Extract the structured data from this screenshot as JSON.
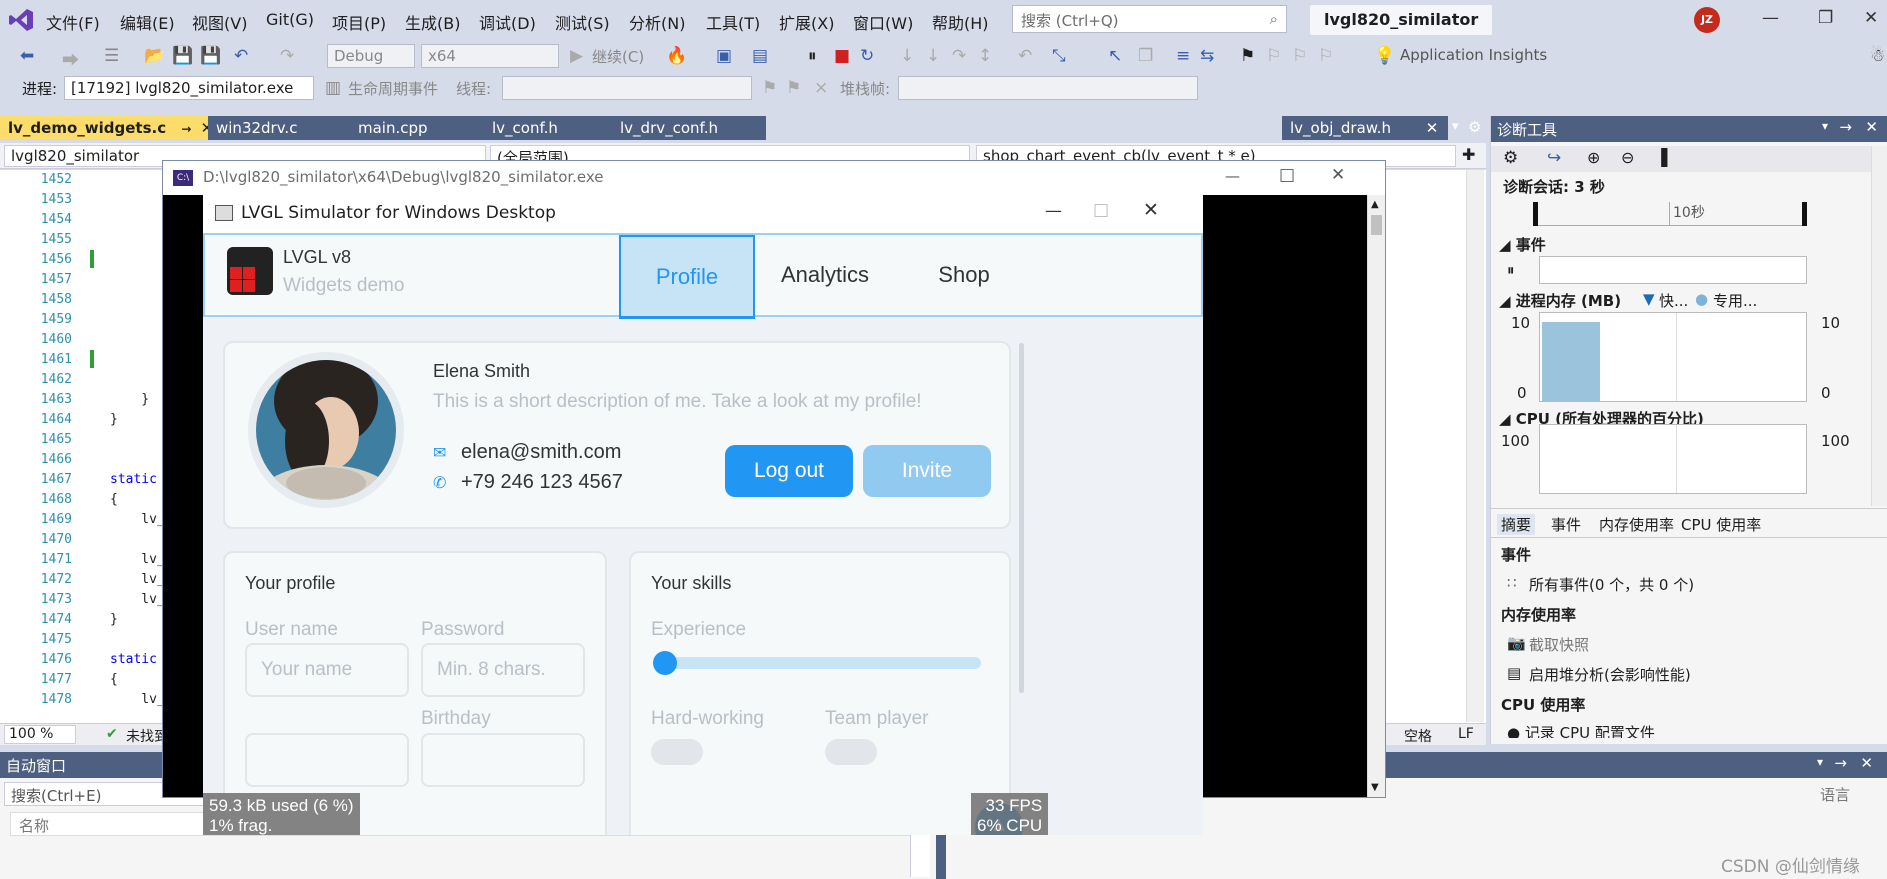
{
  "menubar": {
    "items": [
      "文件(F)",
      "编辑(E)",
      "视图(V)",
      "Git(G)",
      "项目(P)",
      "生成(B)",
      "调试(D)",
      "测试(S)",
      "分析(N)",
      "工具(T)",
      "扩展(X)",
      "窗口(W)",
      "帮助(H)"
    ],
    "search_placeholder": "搜索 (Ctrl+Q)",
    "project_name": "lvgl820_similator",
    "user_initials": "JZ"
  },
  "toolbar": {
    "config": "Debug",
    "platform": "x64",
    "continue_label": "继续(C)",
    "insights": "Application Insights"
  },
  "debugbar": {
    "process_label": "进程:",
    "process_value": "[17192] lvgl820_similator.exe",
    "lifecycle_label": "生命周期事件",
    "thread_label": "线程:",
    "stack_label": "堆栈帧:"
  },
  "tabs": [
    "lv_demo_widgets.c",
    "win32drv.c",
    "main.cpp",
    "lv_conf.h",
    "lv_drv_conf.h",
    "lv_obj_draw.h"
  ],
  "nav": {
    "project": "lvgl820_similator",
    "scope": "(全局范围)",
    "func": "shop_chart_event_cb(lv_event_t * e)"
  },
  "editor": {
    "lines": [
      "1452",
      "1453",
      "1454",
      "1455",
      "1456",
      "1457",
      "1458",
      "1459",
      "1460",
      "1461",
      "1462",
      "1463",
      "1464",
      "1465",
      "1466",
      "1467",
      "1468",
      "1469",
      "1470",
      "1471",
      "1472",
      "1473",
      "1474",
      "1475",
      "1476",
      "1477",
      "1478"
    ],
    "zoom": "100 %",
    "status_left": "未找到",
    "status_space": "空格",
    "status_lf": "LF"
  },
  "diag": {
    "title": "诊断工具",
    "session": "诊断会话: 3 秒",
    "timeline_label": "10秒",
    "events_section": "事件",
    "memory_section": "进程内存 (MB)",
    "memory_legend_fast": "快...",
    "memory_legend_private": "专用...",
    "memory_axis_max": "10",
    "memory_axis_min": "0",
    "memory_level": 0.9,
    "cpu_section": "CPU (所有处理器的百分比)",
    "cpu_axis_max": "100",
    "cpu_axis_min": "0",
    "tabs": [
      "摘要",
      "事件",
      "内存使用率",
      "CPU 使用率"
    ],
    "summary_events": "事件",
    "all_events": "所有事件(0 个，共 0 个)",
    "mem_usage": "内存使用率",
    "snapshot": "截取快照",
    "heap_analysis": "启用堆分析(会影响性能)",
    "cpu_usage": "CPU 使用率",
    "cpu_profile": "记录 CPU 配置文件"
  },
  "auto_window": {
    "title": "自动窗口",
    "search": "搜索(Ctrl+E)",
    "col_name": "名称",
    "lang": "语言"
  },
  "watermark": "CSDN @仙剑情缘",
  "exe": {
    "path": "D:\\lvgl820_similator\\x64\\Debug\\lvgl820_similator.exe",
    "lv_title": "LVGL Simulator for Windows Desktop",
    "logo_title": "LVGL v8",
    "logo_subtitle": "Widgets demo",
    "tabs": [
      "Profile",
      "Analytics",
      "Shop"
    ],
    "profile": {
      "name": "Elena Smith",
      "description": "This is a short description of me. Take a look at my profile!",
      "email": "elena@smith.com",
      "phone": "+79 246 123 4567",
      "logout": "Log out",
      "invite": "Invite"
    },
    "your_profile": {
      "title": "Your profile",
      "username_label": "User name",
      "username_ph": "Your name",
      "password_label": "Password",
      "password_ph": "Min. 8 chars.",
      "birthday_label": "Birthday"
    },
    "skills": {
      "title": "Your skills",
      "experience": "Experience",
      "experience_value": 0.0,
      "hard_working": "Hard-working",
      "team_player": "Team player"
    },
    "mem_overlay": [
      "59.3 kB used (6 %)",
      "1% frag."
    ],
    "perf_overlay": [
      "33 FPS",
      "6% CPU"
    ]
  }
}
